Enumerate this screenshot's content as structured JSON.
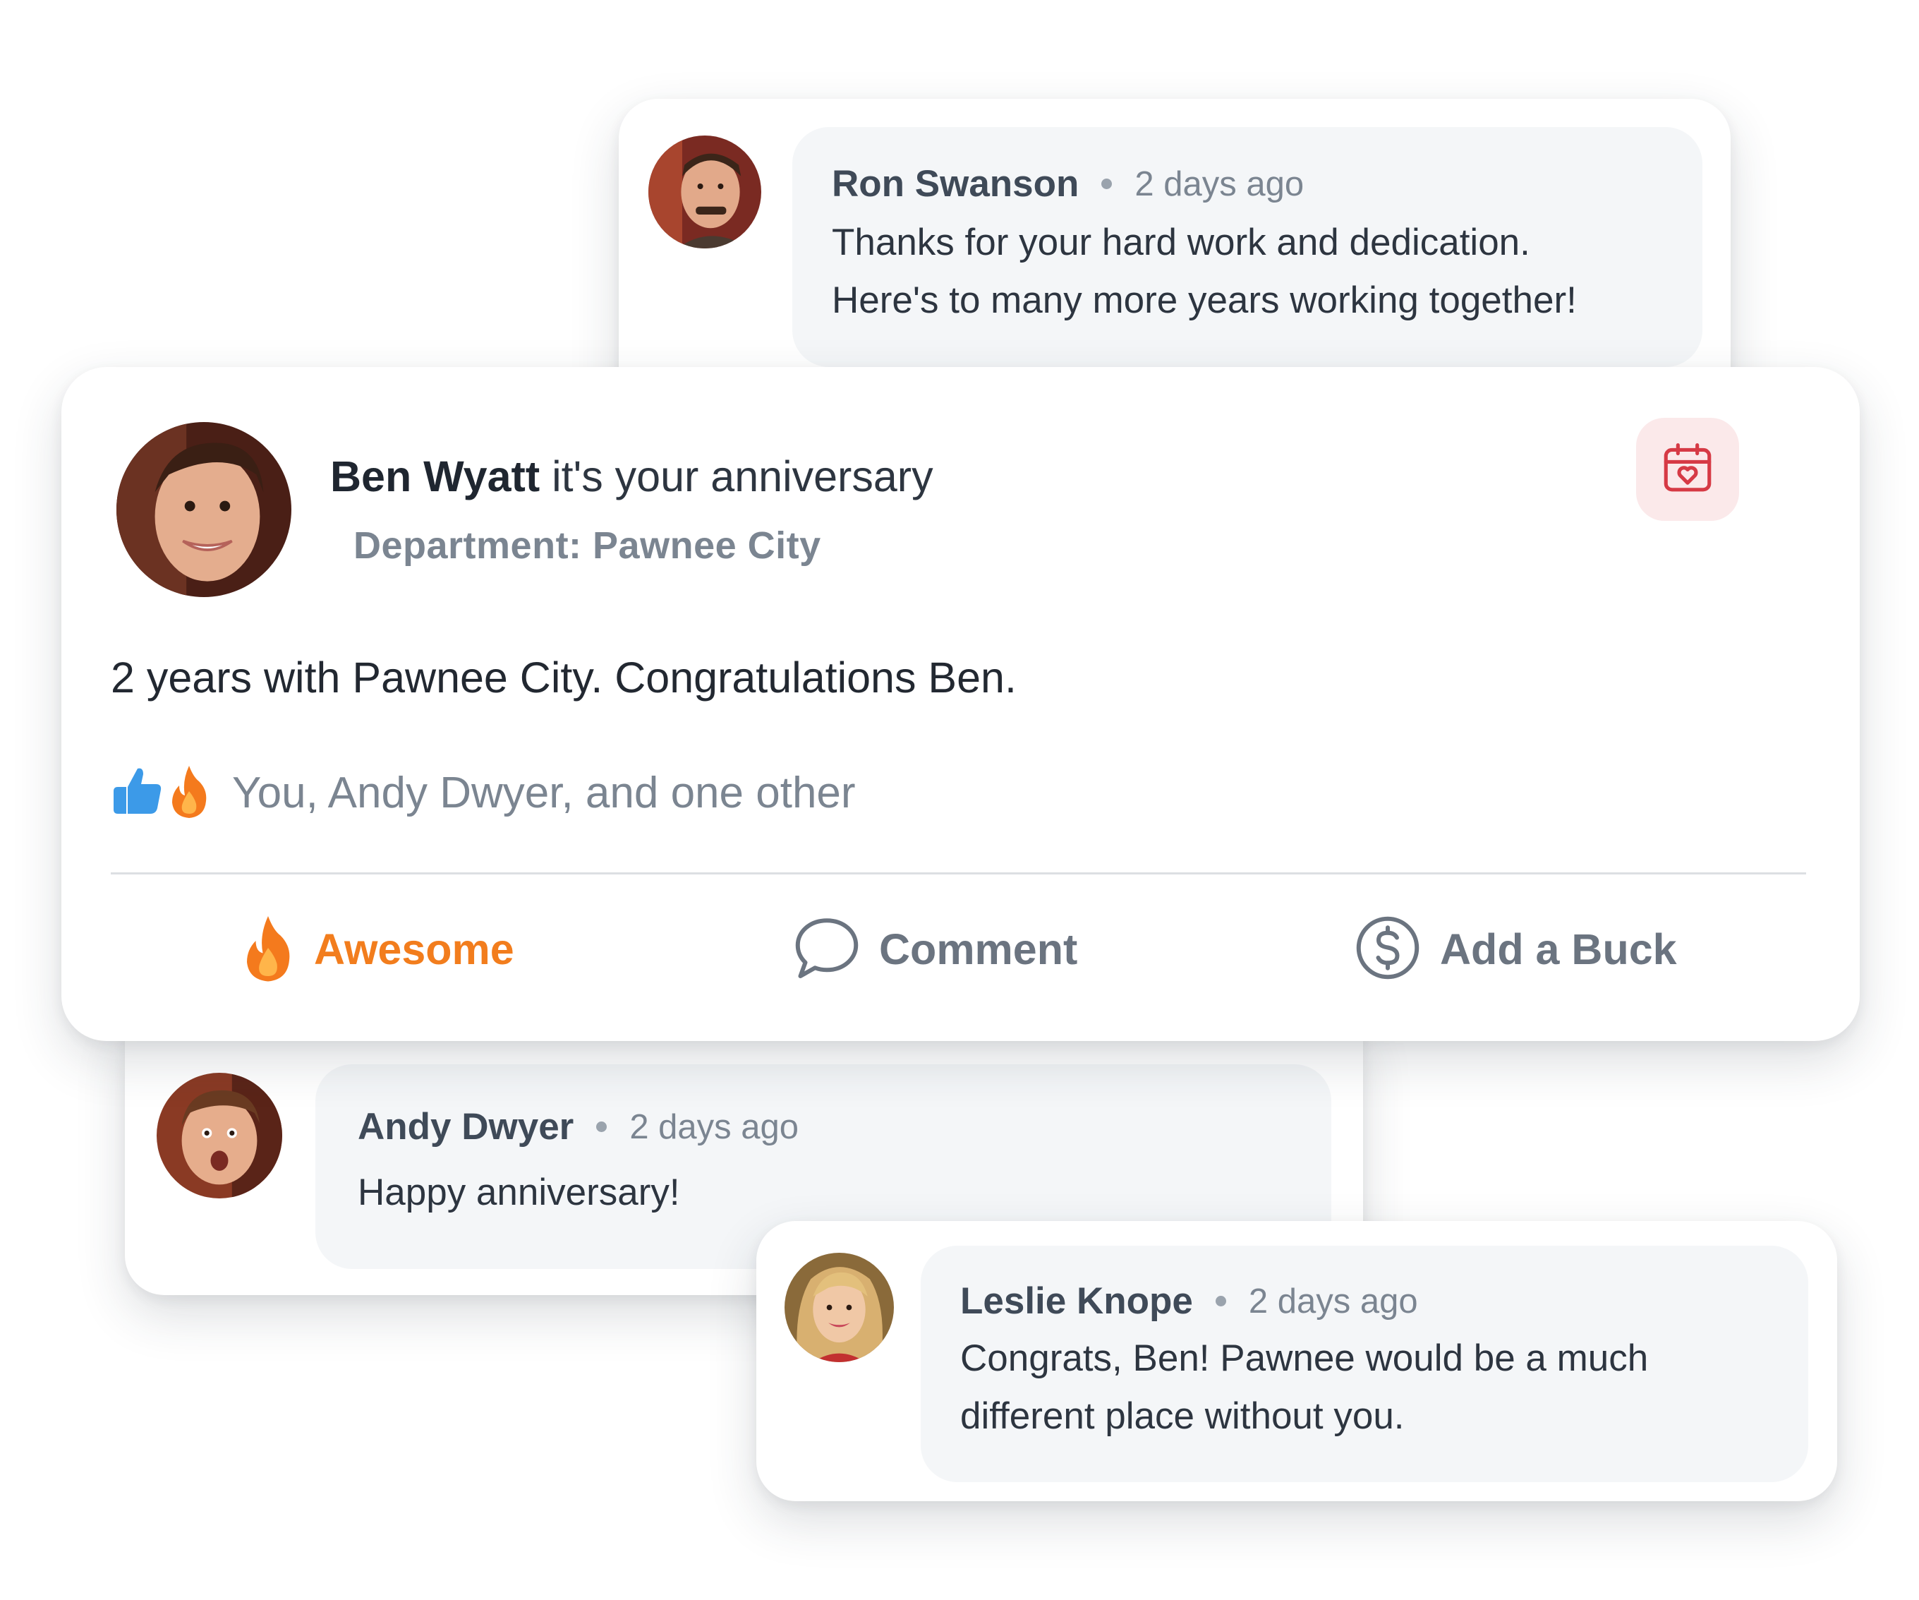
{
  "main_post": {
    "name": "Ben Wyatt",
    "headline_suffix": " it's your anniversary",
    "department": "Department: Pawnee City",
    "body": "2 years with Pawnee City. Congratulations Ben.",
    "reaction_icons": [
      "thumbs-up-icon",
      "fire-icon"
    ],
    "reactions_text": "You, Andy Dwyer, and one other",
    "calendar_icon": "calendar-heart-icon",
    "actions": {
      "awesome": "Awesome",
      "comment": "Comment",
      "add_buck": "Add a Buck"
    }
  },
  "comments": [
    {
      "author": "Ron Swanson",
      "time": "2 days ago",
      "lines": [
        "Thanks for your hard work and dedication.",
        "Here's to many more years working together!"
      ]
    },
    {
      "author": "Andy Dwyer",
      "time": "2 days ago",
      "lines": [
        "Happy anniversary!"
      ]
    },
    {
      "author": "Leslie Knope",
      "time": "2 days ago",
      "lines": [
        "Congrats, Ben! Pawnee would be a much",
        "different place without you."
      ]
    }
  ],
  "colors": {
    "accent_orange": "#f27d1d",
    "calendar_red": "#d63a45",
    "calendar_bg": "#fbe9ea",
    "thumbs_blue": "#3c9ae8",
    "muted_text": "#7b8591",
    "bubble_bg": "#f4f6f8"
  }
}
